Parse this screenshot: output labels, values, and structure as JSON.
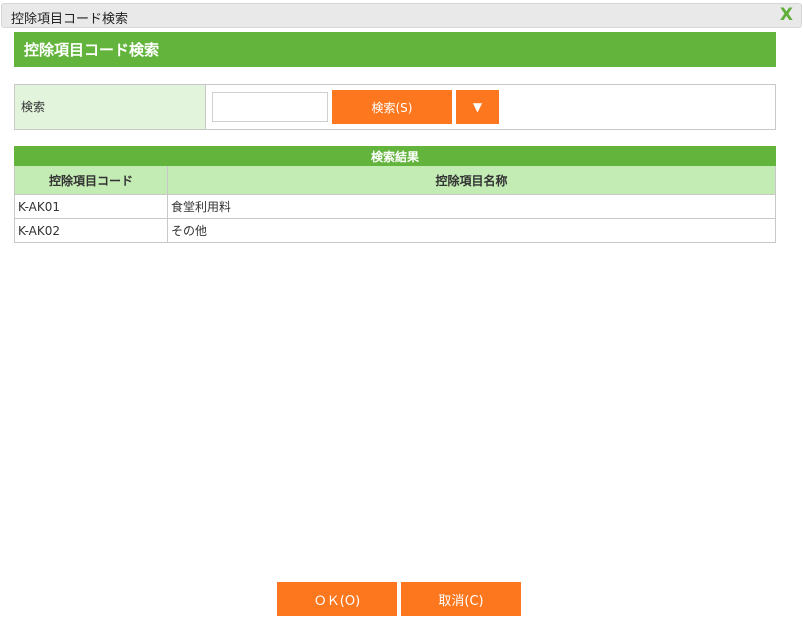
{
  "window": {
    "title": "控除項目コード検索",
    "close": "X"
  },
  "header": {
    "title": "控除項目コード検索"
  },
  "search": {
    "label": "検索",
    "value": "",
    "button": "検索(S)",
    "dropdown": "▼"
  },
  "results": {
    "caption": "検索結果",
    "columns": [
      "控除項目コード",
      "控除項目名称"
    ],
    "rows": [
      [
        "K-AK01",
        "食堂利用料"
      ],
      [
        "K-AK02",
        "その他"
      ]
    ]
  },
  "footer": {
    "ok": "ＯＫ(O)",
    "cancel": "取消(C)"
  }
}
